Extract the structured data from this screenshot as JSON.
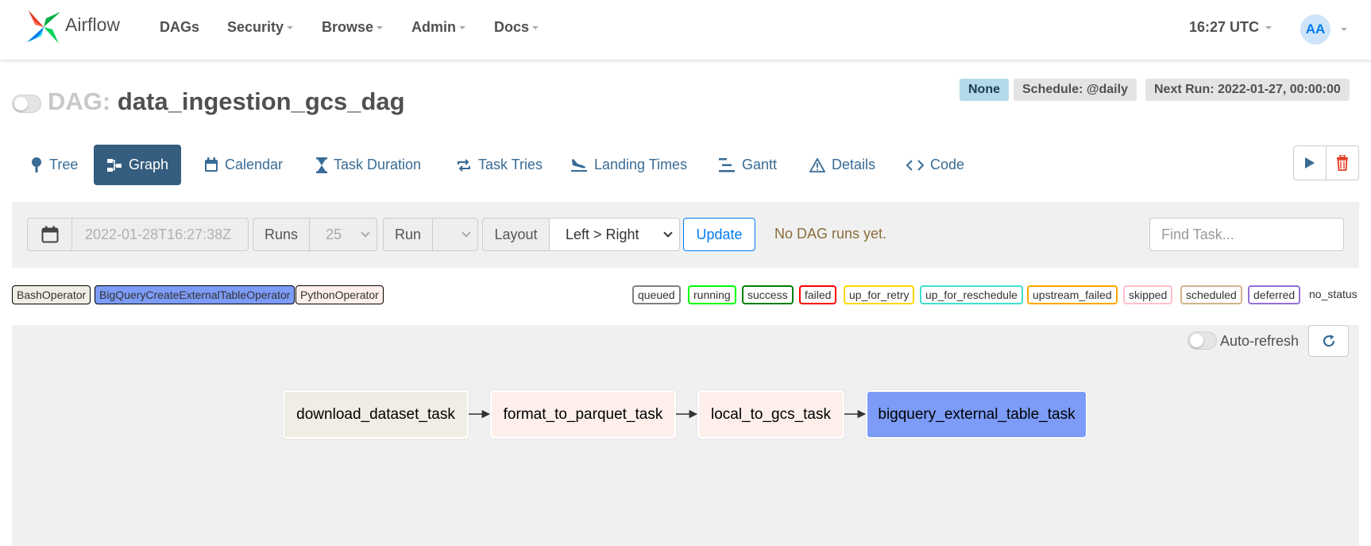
{
  "app": {
    "name": "Airflow"
  },
  "nav": {
    "items": [
      {
        "label": "DAGs",
        "has_caret": false
      },
      {
        "label": "Security",
        "has_caret": true
      },
      {
        "label": "Browse",
        "has_caret": true
      },
      {
        "label": "Admin",
        "has_caret": true
      },
      {
        "label": "Docs",
        "has_caret": true
      }
    ],
    "time": "16:27 UTC",
    "user_initials": "AA"
  },
  "dag": {
    "prefix": "DAG:",
    "name": "data_ingestion_gcs_dag",
    "badges": {
      "owner": "None",
      "schedule": "Schedule: @daily",
      "next_run": "Next Run: 2022-01-27, 00:00:00"
    }
  },
  "tabs": [
    {
      "label": "Tree",
      "icon": "tree-icon",
      "active": false
    },
    {
      "label": "Graph",
      "icon": "graph-icon",
      "active": true
    },
    {
      "label": "Calendar",
      "icon": "calendar-icon",
      "active": false
    },
    {
      "label": "Task Duration",
      "icon": "hourglass-icon",
      "active": false
    },
    {
      "label": "Task Tries",
      "icon": "retry-icon",
      "active": false
    },
    {
      "label": "Landing Times",
      "icon": "plane-landing-icon",
      "active": false
    },
    {
      "label": "Gantt",
      "icon": "gantt-icon",
      "active": false
    },
    {
      "label": "Details",
      "icon": "warning-icon",
      "active": false
    },
    {
      "label": "Code",
      "icon": "code-icon",
      "active": false
    }
  ],
  "controls": {
    "base_date_value": "2022-01-28T16:27:38Z",
    "runs_label": "Runs",
    "runs_value": "25",
    "run_label": "Run",
    "run_value": "",
    "layout_label": "Layout",
    "layout_value": "Left > Right",
    "layout_options": [
      "Left > Right"
    ],
    "update_label": "Update",
    "status_message": "No DAG runs yet.",
    "find_task_placeholder": "Find Task..."
  },
  "operators": [
    {
      "label": "BashOperator",
      "bg": "#f0ede4",
      "border": "#000000"
    },
    {
      "label": "BigQueryCreateExternalTableOperator",
      "bg": "#7c9cf7",
      "border": "#000000"
    },
    {
      "label": "PythonOperator",
      "bg": "#ffefeb",
      "border": "#000000"
    }
  ],
  "states": [
    {
      "label": "queued",
      "color": "#808080"
    },
    {
      "label": "running",
      "color": "#00ff00"
    },
    {
      "label": "success",
      "color": "#008000"
    },
    {
      "label": "failed",
      "color": "#ff0000"
    },
    {
      "label": "up_for_retry",
      "color": "#ffd700"
    },
    {
      "label": "up_for_reschedule",
      "color": "#40e0d0"
    },
    {
      "label": "upstream_failed",
      "color": "#ffa500"
    },
    {
      "label": "skipped",
      "color": "#ffc0cb"
    },
    {
      "label": "scheduled",
      "color": "#d2b48c"
    },
    {
      "label": "deferred",
      "color": "#9370db"
    }
  ],
  "no_status_label": "no_status",
  "graph": {
    "auto_refresh_label": "Auto-refresh",
    "auto_refresh_on": false,
    "tasks": [
      {
        "id": "download_dataset_task",
        "operator": "BashOperator",
        "bg": "#f0ede4"
      },
      {
        "id": "format_to_parquet_task",
        "operator": "PythonOperator",
        "bg": "#ffefeb"
      },
      {
        "id": "local_to_gcs_task",
        "operator": "PythonOperator",
        "bg": "#ffefeb"
      },
      {
        "id": "bigquery_external_table_task",
        "operator": "BigQueryCreateExternalTableOperator",
        "bg": "#7c9cf7"
      }
    ],
    "edges": [
      [
        "download_dataset_task",
        "format_to_parquet_task"
      ],
      [
        "format_to_parquet_task",
        "local_to_gcs_task"
      ],
      [
        "local_to_gcs_task",
        "bigquery_external_table_task"
      ]
    ]
  }
}
